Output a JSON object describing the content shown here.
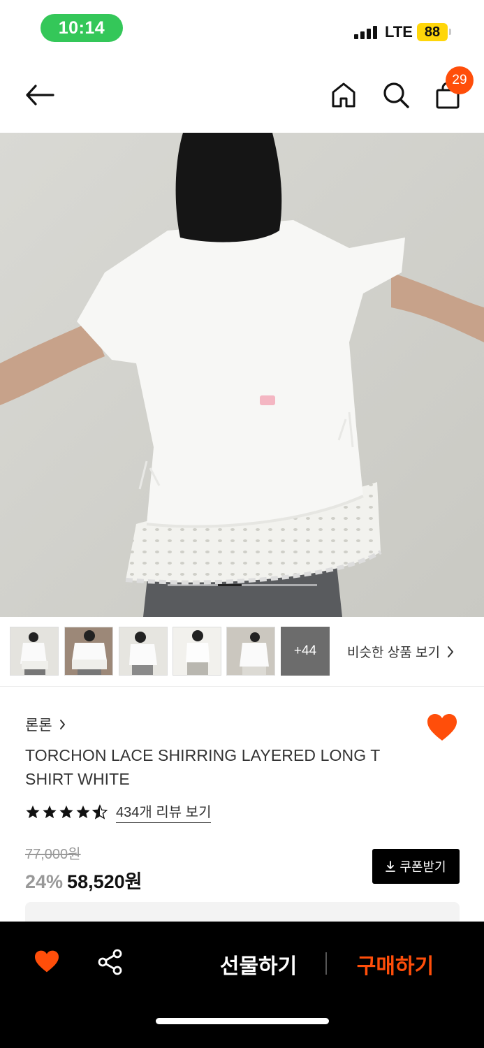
{
  "status_bar": {
    "time": "10:14",
    "network": "LTE",
    "battery": "88",
    "time_pill_color": "#34c759",
    "battery_color": "#ffd60a"
  },
  "nav": {
    "back_icon": "arrow-left-icon",
    "home_icon": "home-icon",
    "search_icon": "search-icon",
    "cart_icon": "shopping-bag-icon",
    "cart_count": "29",
    "badge_color": "#ff4e0a"
  },
  "hero": {
    "slide_count_shown": "image-carousel"
  },
  "thumbnails": {
    "more_label": "+44",
    "similar_label": "비슷한 상품 보기"
  },
  "product": {
    "brand": "론론",
    "name": "TORCHON LACE SHIRRING LAYERED LONG T SHIRT WHITE",
    "rating": 4.5,
    "review_link": "434개 리뷰 보기",
    "original_price": "77,000원",
    "discount": "24%",
    "sale_price": "58,520원",
    "coupon_label": "쿠폰받기",
    "liked": true,
    "accent_color": "#ff4e0a"
  },
  "bottom_bar": {
    "gift_label": "선물하기",
    "buy_label": "구매하기",
    "like_icon": "heart-icon",
    "share_icon": "share-icon"
  }
}
